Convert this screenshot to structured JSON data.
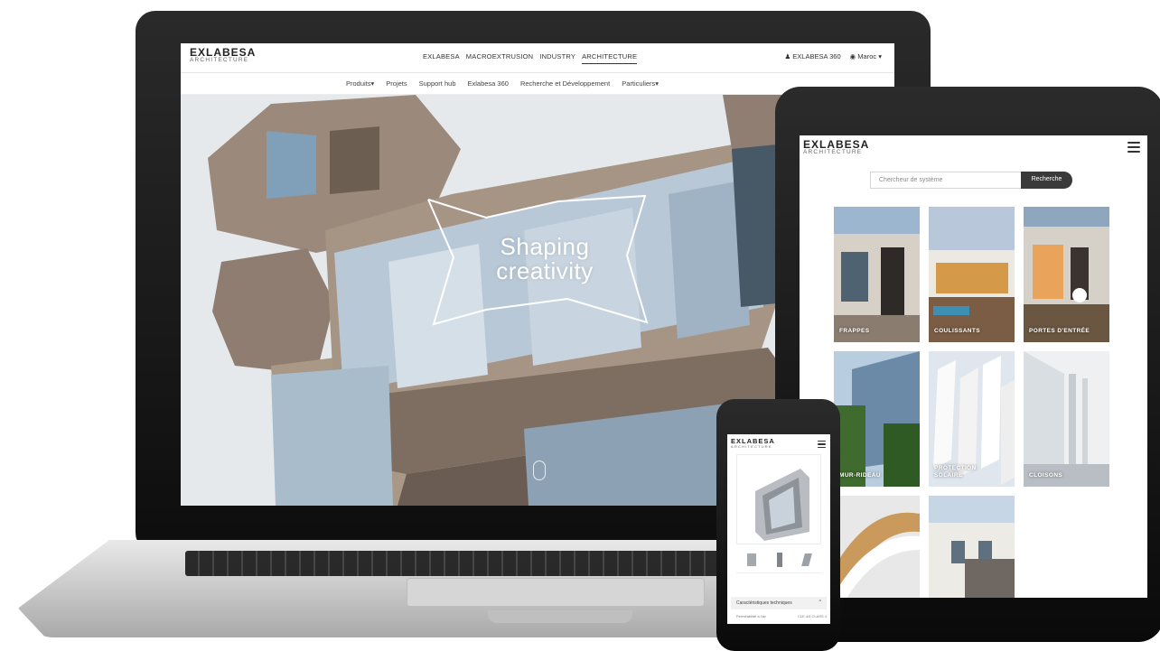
{
  "laptop": {
    "brand": "EXLABESA",
    "brand_sub": "ARCHITECTURE",
    "top_links": [
      "EXLABESA",
      "MACROEXTRUSION",
      "INDUSTRY",
      "ARCHITECTURE"
    ],
    "active_top_link": "ARCHITECTURE",
    "account_link": "EXLABESA 360",
    "region_selector": "Maroc",
    "sub_nav": [
      "Produits",
      "Projets",
      "Support hub",
      "Exlabesa 360",
      "Recherche et Développement",
      "Particuliers"
    ],
    "hero_line1": "Shaping",
    "hero_line2": "creativity",
    "icons": [
      "user-icon",
      "globe-icon",
      "caret-down-icon",
      "mouse-scroll-icon"
    ]
  },
  "tablet": {
    "brand": "EXLABESA",
    "brand_sub": "ARCHITECTURE",
    "search_placeholder": "Chercheur de système",
    "search_button": "Recherche",
    "tiles": [
      {
        "label": "FRAPPES"
      },
      {
        "label": "COULISSANTS"
      },
      {
        "label": "PORTES D'ENTRÉE"
      },
      {
        "label": "MUR-RIDEAU"
      },
      {
        "label_line1": "PROTECTION",
        "label_line2": "SOLAIRE"
      },
      {
        "label": "CLOISONS"
      },
      {
        "label": ""
      },
      {
        "label": ""
      }
    ],
    "icons": [
      "menu-icon"
    ]
  },
  "phone": {
    "brand": "EXLABESA",
    "brand_sub": "ARCHITECTURE",
    "accordion_title": "Caractéristiques techniques",
    "row_label": "Perméabilité à l'air",
    "row_value": "CLE 4/4 CLASS 4",
    "icons": [
      "menu-icon",
      "chevron-up-icon"
    ]
  },
  "colors": {
    "dark_button": "#3a3a3a",
    "device_frame": "#111111",
    "hero_facade": "#8d7c6e",
    "text_dark": "#222222"
  }
}
